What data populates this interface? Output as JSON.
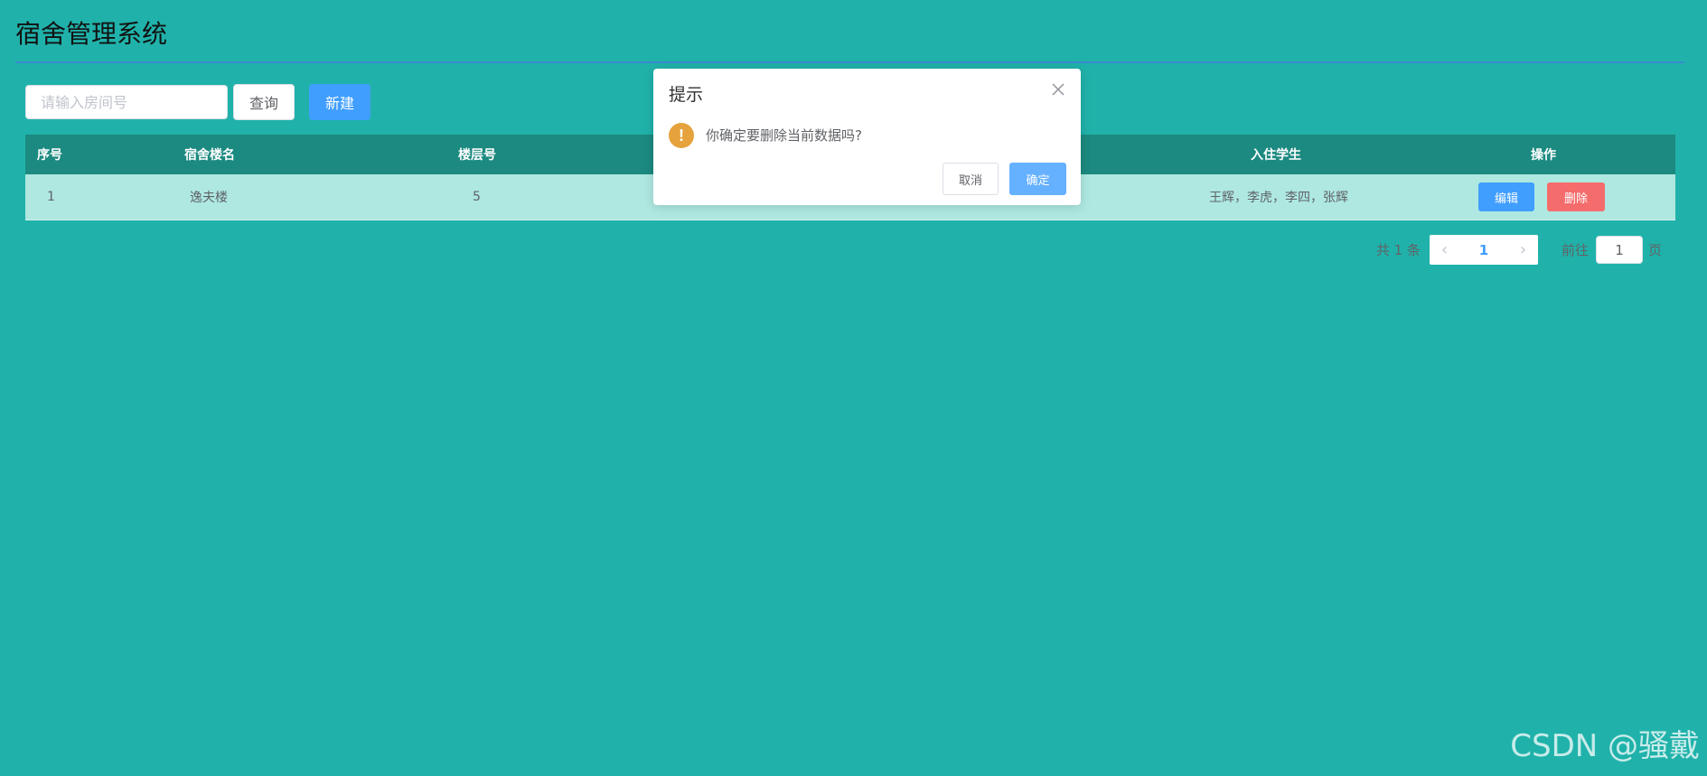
{
  "app": {
    "title": "宿舍管理系统"
  },
  "toolbar": {
    "search_placeholder": "请输入房间号",
    "search_value": "",
    "query_label": "查询",
    "new_label": "新建"
  },
  "table": {
    "headers": [
      "序号",
      "宿舍楼名",
      "楼层号",
      "入住学生",
      "操作"
    ],
    "rows": [
      {
        "index": "1",
        "building": "逸夫楼",
        "floor": "5",
        "students": "王辉，李虎，李四，张辉",
        "edit_label": "编辑",
        "delete_label": "删除"
      }
    ]
  },
  "pagination": {
    "total_text": "共 1 条",
    "current_page": "1",
    "goto_label": "前往",
    "jump_value": "1",
    "page_unit": "页"
  },
  "dialog": {
    "title": "提示",
    "message": "你确定要删除当前数据吗?",
    "warning_symbol": "!",
    "cancel_label": "取消",
    "confirm_label": "确定"
  },
  "watermark": {
    "text": "CSDN @骚戴"
  },
  "colors": {
    "background": "#20b2aa",
    "table_header": "#1c8a80",
    "table_row": "#aee8e1",
    "primary": "#409eff",
    "danger": "#f56c6c",
    "warning": "#e6a23c"
  }
}
